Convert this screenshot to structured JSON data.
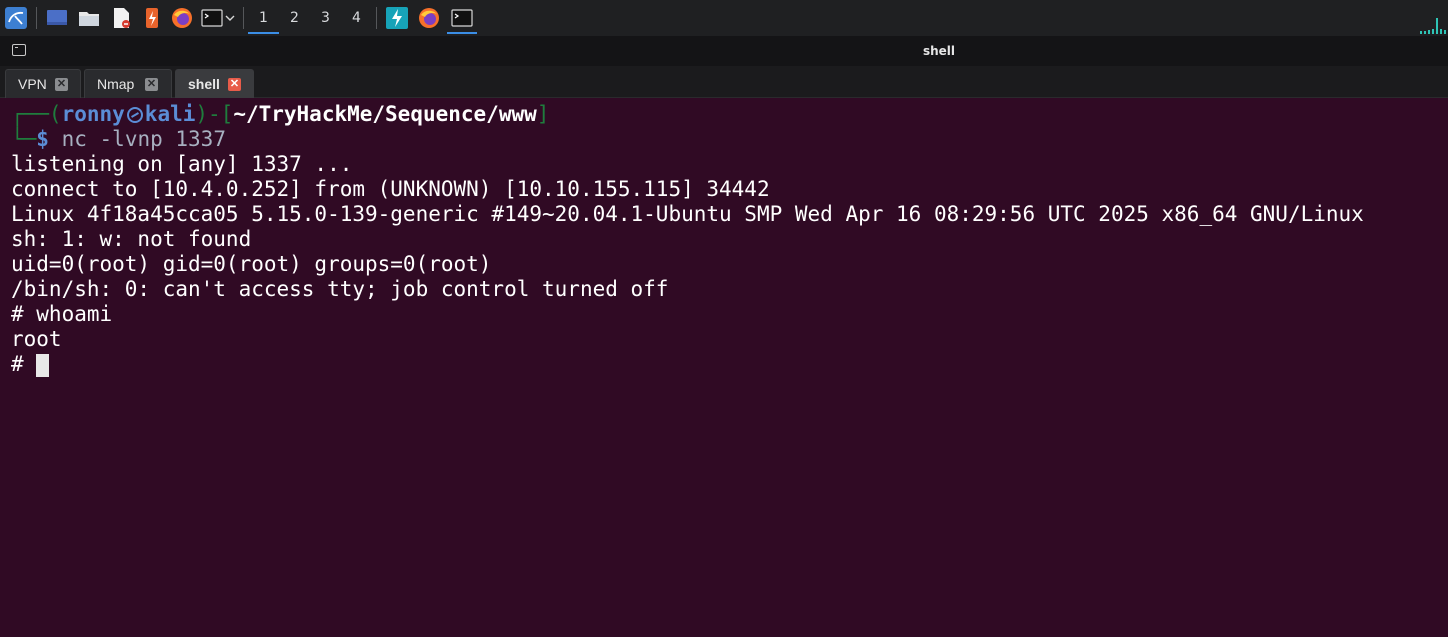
{
  "panel": {
    "launchers": [
      {
        "name": "kali-menu-icon"
      },
      {
        "name": "show-desktop-icon"
      },
      {
        "name": "file-manager-icon"
      },
      {
        "name": "text-editor-icon"
      },
      {
        "name": "burpsuite-icon"
      },
      {
        "name": "firefox-icon"
      },
      {
        "name": "terminal-icon"
      }
    ],
    "workspaces": [
      "1",
      "2",
      "3",
      "4"
    ],
    "active_workspace": "1",
    "accent": "#3b8ee6"
  },
  "window": {
    "title": "shell"
  },
  "tabs": [
    {
      "label": "VPN",
      "close": "✕",
      "selected": false
    },
    {
      "label": "Nmap",
      "close": "✕",
      "selected": false
    },
    {
      "label": "shell",
      "close": "✕",
      "selected": true
    }
  ],
  "terminal": {
    "prompt": {
      "corner_top": "┌──(",
      "user": "ronny",
      "host": "kali",
      "bracket_mid": ")-[",
      "path": "~/TryHackMe/Sequence/www",
      "bracket_end": "]",
      "corner_bottom": "└─",
      "dollar": "$",
      "command": "nc -lvnp 1337"
    },
    "output": [
      "listening on [any] 1337 ...",
      "connect to [10.4.0.252] from (UNKNOWN) [10.10.155.115] 34442",
      "Linux 4f18a45cca05 5.15.0-139-generic #149~20.04.1-Ubuntu SMP Wed Apr 16 08:29:56 UTC 2025 x86_64 GNU/Linux",
      "sh: 1: w: not found",
      "uid=0(root) gid=0(root) groups=0(root)",
      "/bin/sh: 0: can't access tty; job control turned off",
      "# whoami",
      "root",
      "# "
    ],
    "colors": {
      "background": "#300a24",
      "frame": "#1f7d3d",
      "user": "#5b8dd6",
      "text": "#ffffff"
    }
  }
}
